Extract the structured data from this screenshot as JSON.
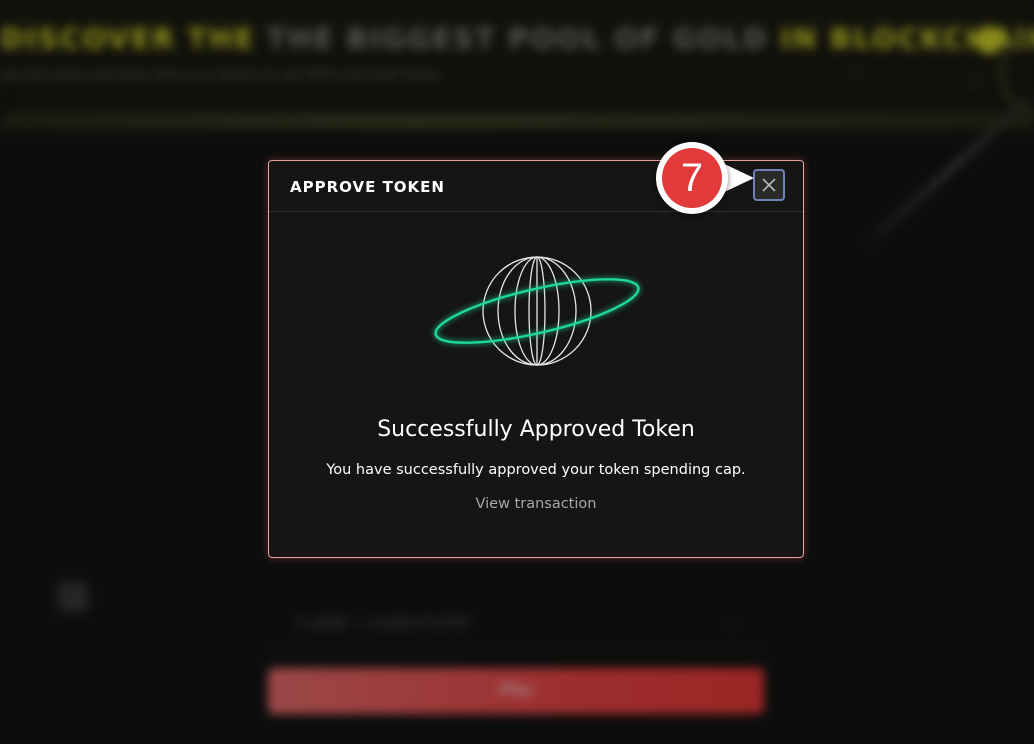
{
  "background": {
    "headline_part1": "DISCOVER THE",
    "headline_part2": "THE BIGGEST POOL OF GOLD",
    "headline_part3": "IN BLOCKCHAIN",
    "subline": "Join the party and play with your tokens to win NFTs and stuff today",
    "field_text": "1 USDC = 0.000175 ETH",
    "button_label": "Play",
    "accent_color": "#dede2a"
  },
  "modal": {
    "title": "APPROVE TOKEN",
    "close_icon": "close-icon",
    "step_badge": "7",
    "success_title": "Successfully Approved Token",
    "success_description": "You have successfully approved your token spending cap.",
    "view_transaction_label": "View transaction",
    "border_color": "#e8a39a",
    "ring_color": "#1ed79a",
    "badge_color": "#e23a3a"
  }
}
